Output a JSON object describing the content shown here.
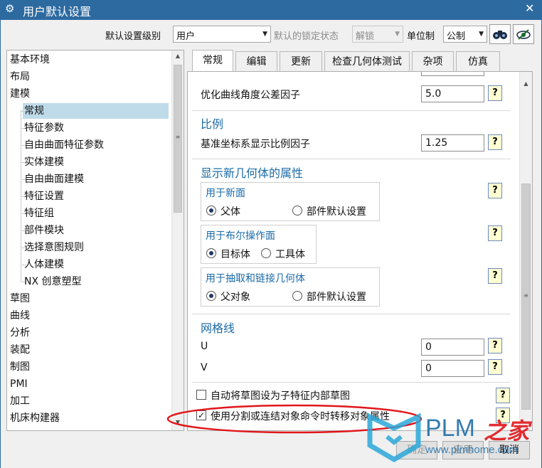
{
  "window": {
    "title": "用户默认设置",
    "close": "✕"
  },
  "toolbar": {
    "level_label": "默认设置级别",
    "level_value": "用户",
    "lock_label": "默认的锁定状态",
    "lock_value": "解锁",
    "unit_label": "单位制",
    "unit_value": "公制"
  },
  "tree": {
    "items": [
      {
        "label": "基本环境",
        "level": 0
      },
      {
        "label": "布局",
        "level": 0
      },
      {
        "label": "建模",
        "level": 0
      },
      {
        "label": "常规",
        "level": 1,
        "selected": true
      },
      {
        "label": "特征参数",
        "level": 1
      },
      {
        "label": "自由曲面特征参数",
        "level": 1
      },
      {
        "label": "实体建模",
        "level": 1
      },
      {
        "label": "自由曲面建模",
        "level": 1
      },
      {
        "label": "特征设置",
        "level": 1
      },
      {
        "label": "特征组",
        "level": 1
      },
      {
        "label": "部件模块",
        "level": 1
      },
      {
        "label": "选择意图规则",
        "level": 1
      },
      {
        "label": "人体建模",
        "level": 1
      },
      {
        "label": "NX 创意塑型",
        "level": 1
      },
      {
        "label": "草图",
        "level": 0
      },
      {
        "label": "曲线",
        "level": 0
      },
      {
        "label": "分析",
        "level": 0
      },
      {
        "label": "装配",
        "level": 0
      },
      {
        "label": "制图",
        "level": 0
      },
      {
        "label": "PMI",
        "level": 0
      },
      {
        "label": "加工",
        "level": 0
      },
      {
        "label": "机床构建器",
        "level": 0
      }
    ]
  },
  "tabs": [
    {
      "label": "常规",
      "active": true
    },
    {
      "label": "编辑"
    },
    {
      "label": "更新"
    },
    {
      "label": "检查几何体测试"
    },
    {
      "label": "杂项"
    },
    {
      "label": "仿真"
    }
  ],
  "panel": {
    "curve_tol_label": "优化曲线角度公差因子",
    "curve_tol_value": "5.0",
    "scale_title": "比例",
    "scale_label": "基准坐标系显示比例因子",
    "scale_value": "1.25",
    "newgeo_title": "显示新几何体的属性",
    "grp1_title": "用于新面",
    "grp1_opt1": "父体",
    "grp1_opt2": "部件默认设置",
    "grp2_title": "用于布尔操作面",
    "grp2_opt1": "目标体",
    "grp2_opt2": "工具体",
    "grp3_title": "用于抽取和链接几何体",
    "grp3_opt1": "父对象",
    "grp3_opt2": "部件默认设置",
    "grid_title": "网格线",
    "u_label": "U",
    "u_value": "0",
    "v_label": "V",
    "v_value": "0",
    "chk1_label": "自动将草图设为子特征内部草图",
    "chk2_label": "使用分割或连结对象命令时转移对象属性",
    "help": "?"
  },
  "buttons": {
    "ok": "确定",
    "apply": "应用",
    "cancel": "取消"
  },
  "watermark": {
    "brand": "PLM",
    "brand_cn": "之家",
    "url": "www.plmhome.com"
  },
  "colors": {
    "titlebar": "#2d6aa0",
    "selected": "#bfdbea",
    "section_head": "#1a6aa8",
    "highlight": "#e0161b"
  }
}
